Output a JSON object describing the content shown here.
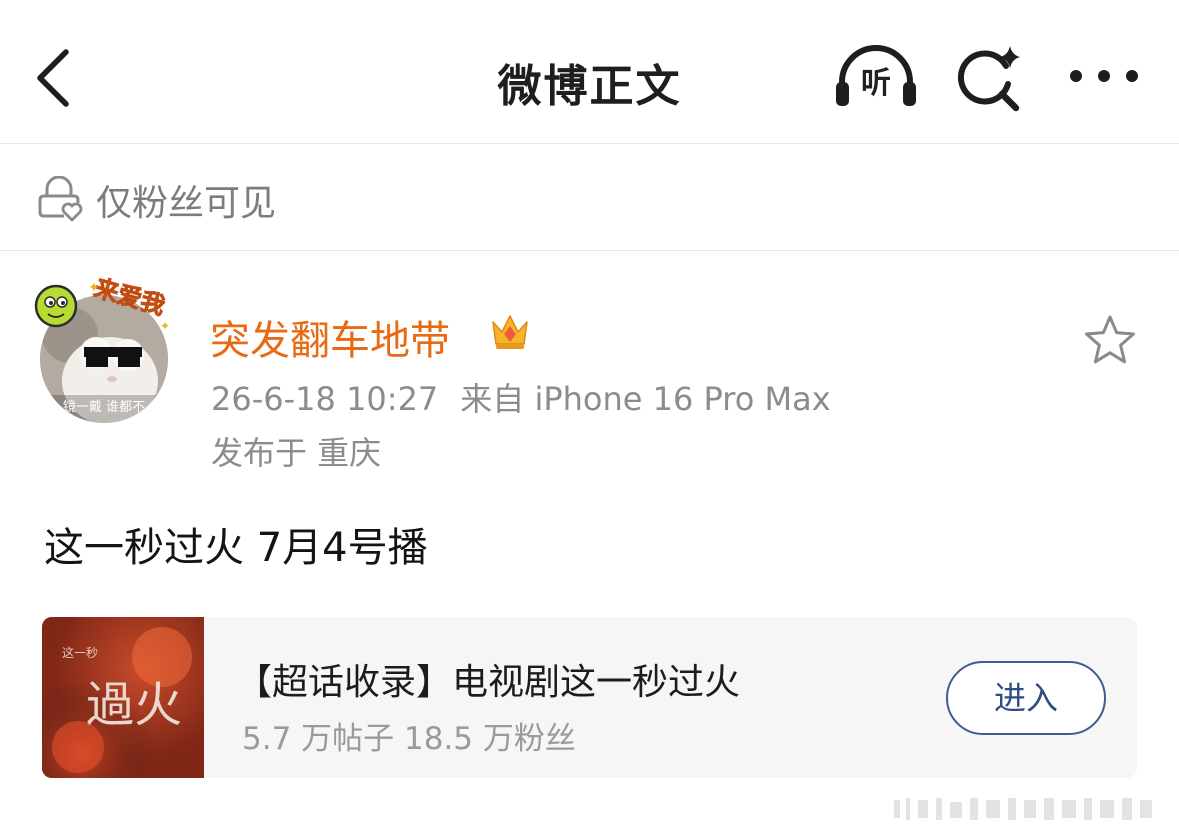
{
  "nav": {
    "title": "微博正文",
    "listen_label": "听"
  },
  "post_visibility": {
    "text": "仅粉丝可见"
  },
  "author": {
    "name": "突发翻车地带",
    "timestamp": "26-6-18 10:27",
    "source": "来自 iPhone 16 Pro Max",
    "location": "发布于 重庆",
    "avatar_sticker_text": "来爱我",
    "avatar_caption": "镜一戴 谁都不"
  },
  "post": {
    "text": "这一秒过火 7月4号播"
  },
  "topic_card": {
    "title": "【超话收录】电视剧这一秒过火",
    "stats": "5.7 万帖子 18.5 万粉丝",
    "enter_label": "进入",
    "thumb_text": "過火",
    "thumb_side_text": "这一秒"
  },
  "colors": {
    "author_name": "#e86a12",
    "enter_button": "#3f5c8f",
    "muted_text": "#8c8c8c"
  },
  "icons": [
    "back-arrow-icon",
    "headphones-icon",
    "search-sparkle-icon",
    "more-dots-icon",
    "lock-heart-icon",
    "crown-icon",
    "star-outline-icon"
  ]
}
